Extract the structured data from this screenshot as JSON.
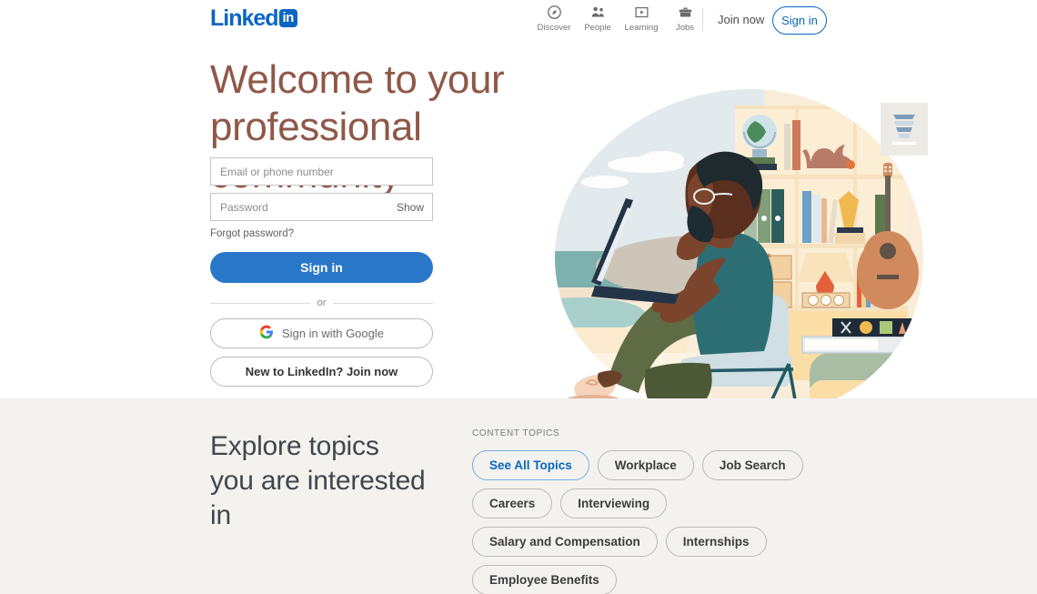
{
  "header": {
    "logo_word": "Linked",
    "logo_box": "in",
    "nav": [
      {
        "label": "Discover",
        "icon": "compass-icon"
      },
      {
        "label": "People",
        "icon": "people-icon"
      },
      {
        "label": "Learning",
        "icon": "learning-icon"
      },
      {
        "label": "Jobs",
        "icon": "briefcase-icon"
      }
    ],
    "join_now": "Join now",
    "sign_in": "Sign in",
    "accent_color": "#0a66c2"
  },
  "hero": {
    "title": "Welcome to your professional community",
    "title_color": "#8f5849",
    "email_placeholder": "Email or phone number",
    "email_value": "",
    "password_placeholder": "Password",
    "password_value": "",
    "show_label": "Show",
    "forgot_password": "Forgot password?",
    "sign_in_button": "Sign in",
    "or_label": "or",
    "google_button": "Sign in with Google",
    "google_icon": "google-g-icon",
    "join_button": "New to LinkedIn? Join now",
    "primary_color": "#2977c9"
  },
  "topics": {
    "heading": "Explore topics you are interested in",
    "section_label": "CONTENT TOPICS",
    "background": "#f3f2ef",
    "pills": [
      {
        "label": "See All Topics",
        "active": true
      },
      {
        "label": "Workplace",
        "active": false
      },
      {
        "label": "Job Search",
        "active": false
      },
      {
        "label": "Careers",
        "active": false
      },
      {
        "label": "Interviewing",
        "active": false
      },
      {
        "label": "Salary and Compensation",
        "active": false
      },
      {
        "label": "Internships",
        "active": false
      },
      {
        "label": "Employee Benefits",
        "active": false
      }
    ]
  },
  "illustration": {
    "name": "person-working-from-home-illustration",
    "description": "Man with glasses and beard seated in a chair with a laptop in front of a bookshelf with globe, cat, binders, lamp, guitar and books"
  }
}
